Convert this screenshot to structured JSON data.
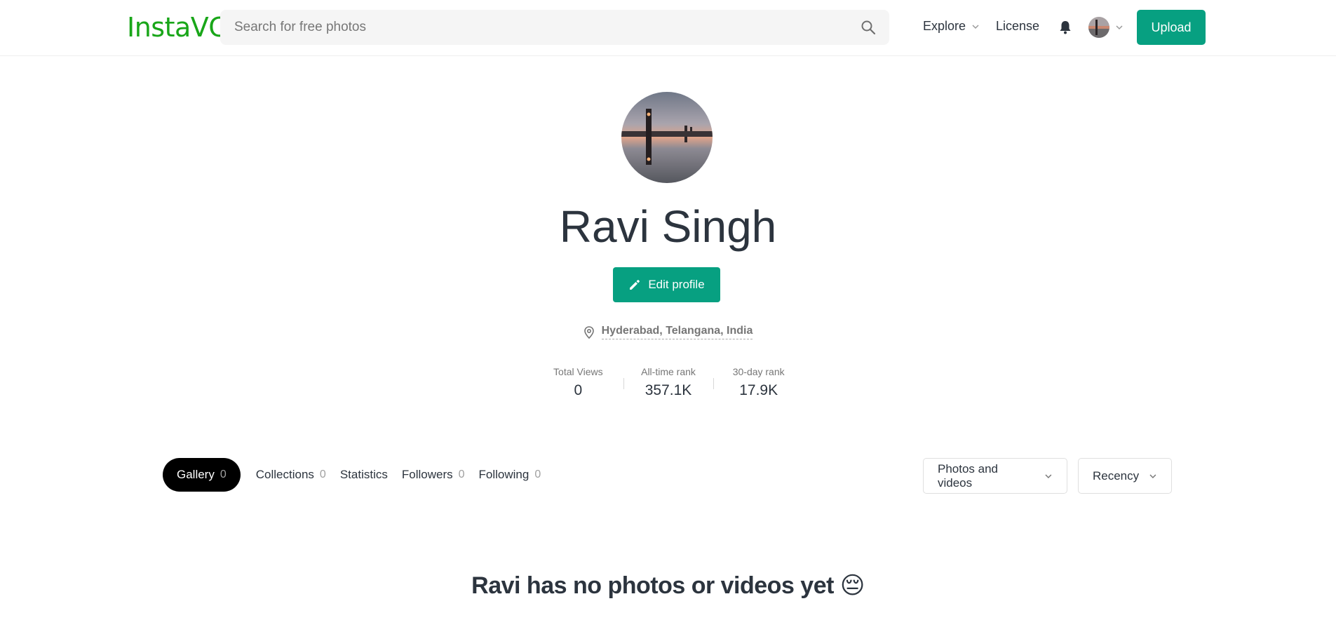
{
  "header": {
    "logo": "InstaVC",
    "search_placeholder": "Search for free photos",
    "nav": {
      "explore": "Explore",
      "license": "License"
    },
    "upload_label": "Upload",
    "accent": "#07a081",
    "logo_color": "#19a619"
  },
  "profile": {
    "name": "Ravi Singh",
    "edit_label": "Edit profile",
    "location": "Hyderabad, Telangana, India",
    "stats": [
      {
        "label": "Total Views",
        "value": "0"
      },
      {
        "label": "All-time rank",
        "value": "357.1K"
      },
      {
        "label": "30-day rank",
        "value": "17.9K"
      }
    ]
  },
  "tabs": [
    {
      "label": "Gallery",
      "count": "0"
    },
    {
      "label": "Collections",
      "count": "0"
    },
    {
      "label": "Statistics",
      "count": ""
    },
    {
      "label": "Followers",
      "count": "0"
    },
    {
      "label": "Following",
      "count": "0"
    }
  ],
  "filters": {
    "media": "Photos and videos",
    "sort": "Recency"
  },
  "empty_message": "Ravi has no photos or videos yet 😔"
}
